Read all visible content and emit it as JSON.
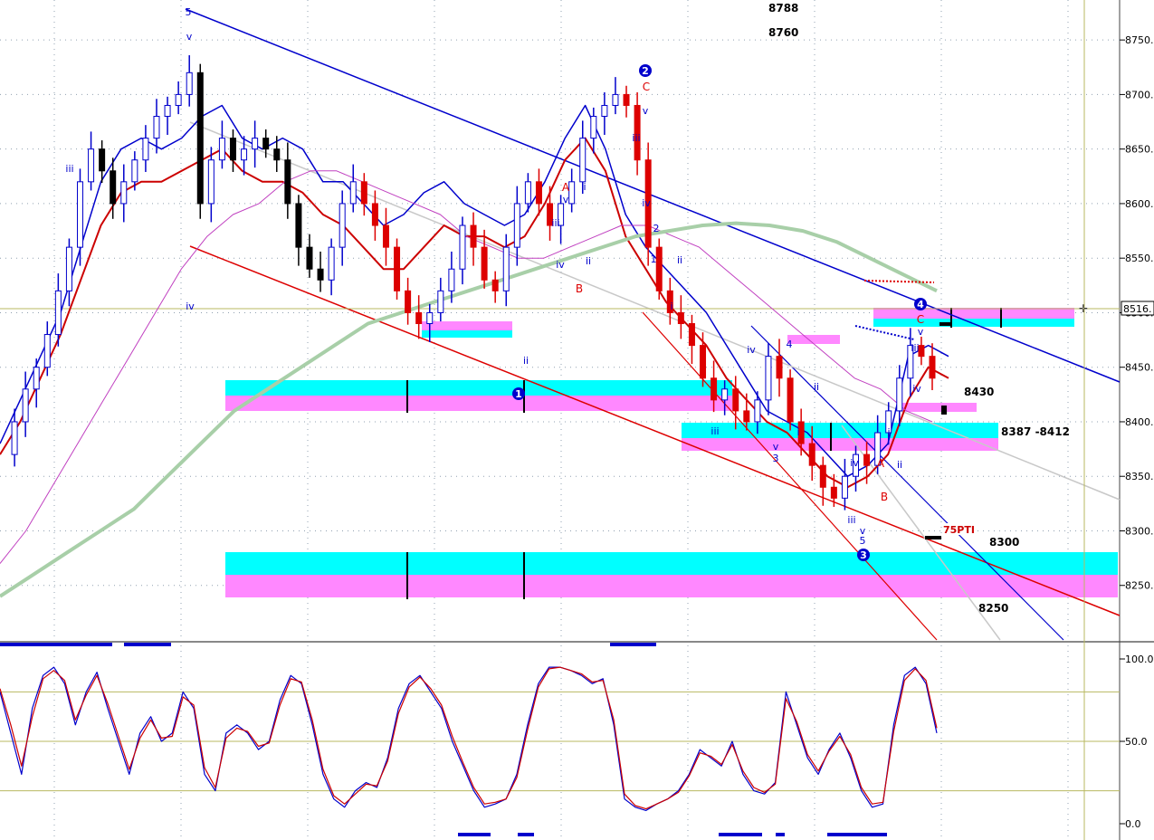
{
  "chart_data": [
    {
      "type": "candlestick",
      "panel": "price",
      "y_axis": {
        "min": 8200,
        "max": 8780,
        "ticks": [
          8250,
          8300,
          8350,
          8400,
          8450,
          8500,
          8550,
          8600,
          8650,
          8700,
          8750
        ],
        "tick_labels": [
          "8250.",
          "8300.",
          "8350.",
          "8400.",
          "8450.",
          "8500.",
          "8550.",
          "8600.",
          "8650.",
          "8700.",
          "8750."
        ],
        "last_price_label": "8516.",
        "last_price": 8516,
        "position": "right"
      },
      "x_range": [
        0,
        100
      ],
      "grid": true,
      "closes": [
        8370,
        8400,
        8430,
        8450,
        8480,
        8520,
        8560,
        8620,
        8650,
        8630,
        8600,
        8620,
        8640,
        8660,
        8680,
        8690,
        8700,
        8720,
        8600,
        8640,
        8660,
        8640,
        8650,
        8660,
        8650,
        8640,
        8600,
        8560,
        8540,
        8530,
        8560,
        8600,
        8620,
        8600,
        8580,
        8560,
        8520,
        8500,
        8490,
        8500,
        8520,
        8540,
        8580,
        8560,
        8530,
        8520,
        8560,
        8600,
        8620,
        8600,
        8580,
        8600,
        8620,
        8660,
        8680,
        8690,
        8700,
        8690,
        8640,
        8560,
        8520,
        8500,
        8490,
        8470,
        8440,
        8420,
        8430,
        8410,
        8400,
        8420,
        8460,
        8440,
        8400,
        8380,
        8360,
        8340,
        8330,
        8350,
        8370,
        8360,
        8390,
        8410,
        8440,
        8470,
        8460,
        8440
      ],
      "series": [
        {
          "name": "",
          "color": "#0000cc",
          "values": [
            8380,
            8420,
            8460,
            8500,
            8560,
            8620,
            8650,
            8660,
            8650,
            8660,
            8680,
            8690,
            8660,
            8650,
            8660,
            8650,
            8620,
            8620,
            8600,
            8580,
            8590,
            8610,
            8620,
            8600,
            8590,
            8580,
            8590,
            8620,
            8660,
            8690,
            8650,
            8590,
            8560,
            8540,
            8520,
            8500,
            8470,
            8440,
            8410,
            8400,
            8390,
            8370,
            8350,
            8360,
            8380,
            8460,
            8470,
            8460
          ]
        },
        {
          "name": "",
          "color": "#cc0000",
          "values": [
            8370,
            8400,
            8440,
            8480,
            8530,
            8580,
            8610,
            8620,
            8620,
            8630,
            8640,
            8650,
            8630,
            8620,
            8620,
            8610,
            8590,
            8580,
            8560,
            8540,
            8540,
            8560,
            8580,
            8570,
            8570,
            8560,
            8570,
            8600,
            8640,
            8660,
            8630,
            8570,
            8540,
            8510,
            8490,
            8470,
            8440,
            8420,
            8400,
            8390,
            8370,
            8350,
            8340,
            8350,
            8370,
            8420,
            8450,
            8440
          ]
        },
        {
          "name": "",
          "color": "#c040c0",
          "values": [
            8270,
            8300,
            8340,
            8380,
            8420,
            8460,
            8500,
            8540,
            8570,
            8590,
            8600,
            8620,
            8630,
            8630,
            8620,
            8610,
            8600,
            8590,
            8570,
            8560,
            8550,
            8550,
            8560,
            8570,
            8580,
            8580,
            8570,
            8560,
            8540,
            8520,
            8500,
            8480,
            8460,
            8440,
            8430,
            8410,
            8400
          ]
        },
        {
          "name": "",
          "color": "#a8cfa8",
          "values": [
            8240,
            8260,
            8280,
            8300,
            8320,
            8350,
            8380,
            8410,
            8430,
            8450,
            8470,
            8490,
            8500,
            8510,
            8520,
            8530,
            8540,
            8550,
            8560,
            8570,
            8575,
            8580,
            8582,
            8580,
            8575,
            8565,
            8550,
            8535,
            8520
          ]
        }
      ],
      "annotations": [
        {
          "text": "8788"
        },
        {
          "text": "8760"
        },
        {
          "text": "8430"
        },
        {
          "text": "8387 -8412"
        },
        {
          "text": "8300"
        },
        {
          "text": "8250"
        },
        {
          "text": "75PTI"
        },
        {
          "text": "1"
        },
        {
          "text": "2"
        },
        {
          "text": "3"
        },
        {
          "text": "4"
        },
        {
          "text": "5"
        },
        {
          "text": "C"
        },
        {
          "text": "A"
        },
        {
          "text": "B"
        },
        {
          "text": "i"
        },
        {
          "text": "ii"
        },
        {
          "text": "iii"
        },
        {
          "text": "iv"
        },
        {
          "text": "v"
        }
      ]
    },
    {
      "type": "line",
      "panel": "oscillator",
      "y_axis": {
        "min": 0,
        "max": 100,
        "ticks": [
          0,
          50,
          100
        ],
        "tick_labels": [
          "0.0",
          "50.0",
          "100.0"
        ],
        "position": "right"
      },
      "reference_lines": [
        80,
        50,
        20
      ],
      "series": [
        {
          "name": "",
          "color": "#0000cc",
          "values": [
            80,
            55,
            30,
            70,
            90,
            95,
            85,
            60,
            80,
            92,
            70,
            50,
            30,
            55,
            65,
            50,
            55,
            80,
            70,
            30,
            20,
            55,
            60,
            55,
            45,
            50,
            75,
            90,
            85,
            60,
            30,
            15,
            10,
            20,
            25,
            22,
            40,
            70,
            85,
            90,
            80,
            70,
            50,
            35,
            20,
            10,
            12,
            15,
            30,
            60,
            85,
            95,
            95,
            93,
            90,
            85,
            88,
            60,
            15,
            10,
            8,
            12,
            15,
            20,
            30,
            45,
            40,
            35,
            50,
            30,
            20,
            18,
            25,
            80,
            60,
            40,
            30,
            45,
            55,
            40,
            20,
            10,
            12,
            60,
            90,
            95,
            85,
            55
          ]
        },
        {
          "name": "",
          "color": "#cc0000",
          "values": [
            82,
            60,
            35,
            65,
            88,
            93,
            87,
            63,
            78,
            90,
            73,
            53,
            33,
            52,
            63,
            52,
            53,
            77,
            72,
            34,
            22,
            52,
            58,
            56,
            47,
            49,
            72,
            88,
            86,
            63,
            33,
            17,
            12,
            18,
            24,
            23,
            38,
            67,
            83,
            89,
            82,
            72,
            53,
            37,
            22,
            12,
            13,
            15,
            28,
            57,
            83,
            94,
            95,
            93,
            91,
            86,
            87,
            63,
            18,
            11,
            9,
            12,
            15,
            19,
            29,
            43,
            41,
            36,
            48,
            32,
            22,
            19,
            24,
            76,
            62,
            42,
            32,
            44,
            53,
            42,
            22,
            12,
            13,
            56,
            87,
            94,
            87,
            58
          ]
        }
      ]
    }
  ]
}
